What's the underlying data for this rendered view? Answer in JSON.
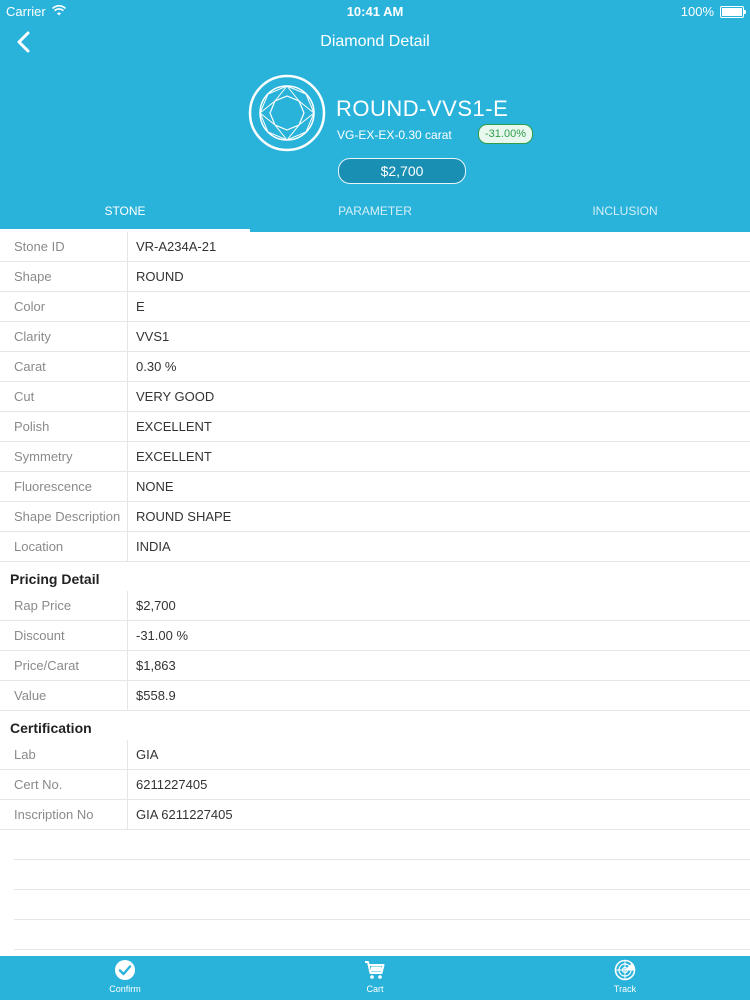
{
  "status_bar": {
    "carrier": "Carrier",
    "time": "10:41 AM",
    "battery": "100%"
  },
  "nav": {
    "title": "Diamond Detail"
  },
  "hero": {
    "title": "ROUND-VVS1-E",
    "subtitle": "VG-EX-EX-0.30 carat",
    "discount": "-31.00%",
    "price": "$2,700"
  },
  "tabs": [
    {
      "label": "STONE",
      "active": true
    },
    {
      "label": "PARAMETER",
      "active": false
    },
    {
      "label": "INCLUSION",
      "active": false
    }
  ],
  "stone_rows": [
    {
      "label": "Stone ID",
      "value": "VR-A234A-21"
    },
    {
      "label": "Shape",
      "value": "ROUND"
    },
    {
      "label": "Color",
      "value": "E"
    },
    {
      "label": "Clarity",
      "value": "VVS1"
    },
    {
      "label": "Carat",
      "value": "0.30 %"
    },
    {
      "label": "Cut",
      "value": "VERY GOOD"
    },
    {
      "label": "Polish",
      "value": "EXCELLENT"
    },
    {
      "label": "Symmetry",
      "value": "EXCELLENT"
    },
    {
      "label": "Fluorescence",
      "value": "NONE"
    },
    {
      "label": "Shape Description",
      "value": "ROUND SHAPE"
    },
    {
      "label": "Location",
      "value": "INDIA"
    }
  ],
  "pricing": {
    "title": "Pricing Detail",
    "rows": [
      {
        "label": "Rap Price",
        "value": "$2,700"
      },
      {
        "label": "Discount",
        "value": "-31.00 %"
      },
      {
        "label": "Price/Carat",
        "value": "$1,863"
      },
      {
        "label": "Value",
        "value": "$558.9"
      }
    ]
  },
  "certification": {
    "title": "Certification",
    "rows": [
      {
        "label": "Lab",
        "value": "GIA"
      },
      {
        "label": "Cert No.",
        "value": "6211227405"
      },
      {
        "label": "Inscription No",
        "value": "GIA 6211227405"
      }
    ]
  },
  "bottom_bar": [
    {
      "label": "Confirm",
      "icon": "check-circle-icon"
    },
    {
      "label": "Cart",
      "icon": "cart-icon"
    },
    {
      "label": "Track",
      "icon": "radar-icon"
    }
  ],
  "colors": {
    "brand": "#2ab3da",
    "discount_badge": "#2e9e4a"
  }
}
